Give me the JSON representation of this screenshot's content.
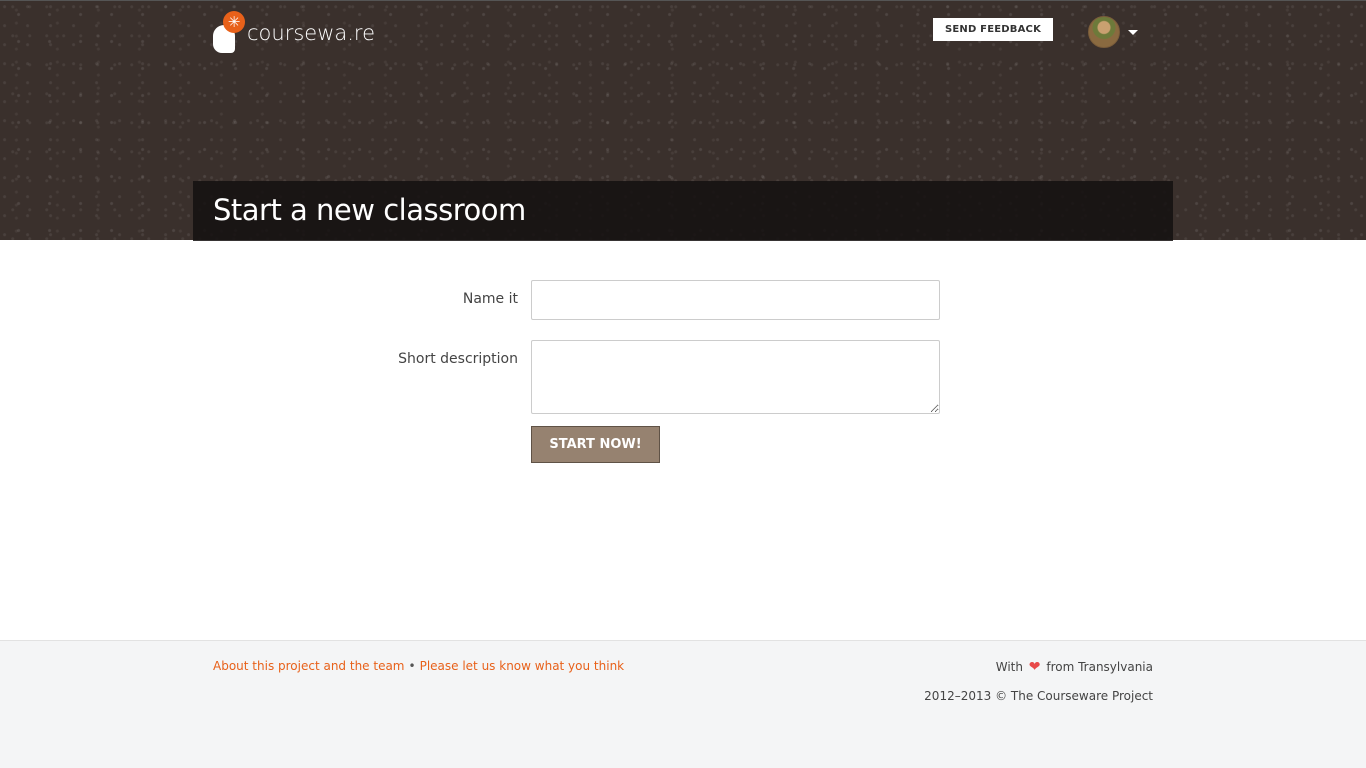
{
  "header": {
    "logo_text": "coursewa.re",
    "feedback_label": "SEND FEEDBACK",
    "title": "Start a new classroom"
  },
  "form": {
    "name_label": "Name it",
    "name_value": "",
    "description_label": "Short description",
    "description_value": "",
    "submit_label": "START NOW!"
  },
  "footer": {
    "about_link": "About this project and the team",
    "separator": "•",
    "feedback_link": "Please let us know what you think",
    "love_prefix": "With",
    "love_suffix": "from Transylvania",
    "copyright": "2012–2013 © The Courseware Project"
  },
  "colors": {
    "accent": "#e8611a",
    "header_bg": "#3a302c",
    "button_bg": "#968270",
    "footer_bg": "#f4f5f6",
    "heart": "#e84a4a"
  },
  "icons": [
    "logo-icon",
    "avatar",
    "caret-down-icon",
    "heart-icon"
  ]
}
